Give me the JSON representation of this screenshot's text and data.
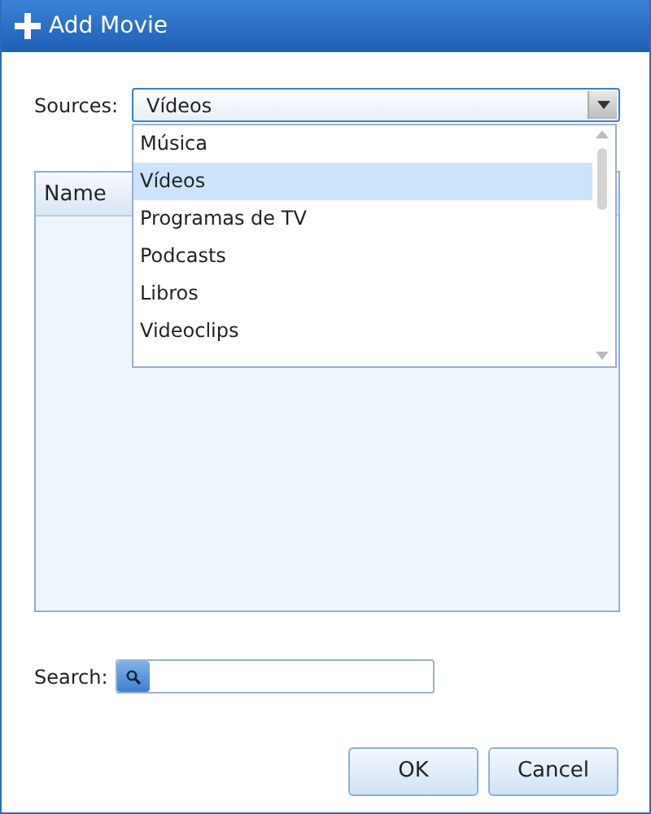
{
  "window": {
    "title": "Add Movie"
  },
  "sources": {
    "label": "Sources:",
    "value": "Vídeos",
    "expanded": true,
    "options": [
      {
        "label": "Música",
        "selected": false
      },
      {
        "label": "Vídeos",
        "selected": true
      },
      {
        "label": "Programas de TV",
        "selected": false
      },
      {
        "label": "Podcasts",
        "selected": false
      },
      {
        "label": "Libros",
        "selected": false
      },
      {
        "label": "Videoclips",
        "selected": false
      }
    ]
  },
  "table": {
    "columns": [
      "Name"
    ]
  },
  "search": {
    "label": "Search:"
  },
  "buttons": [
    "OK",
    "Cancel"
  ]
}
